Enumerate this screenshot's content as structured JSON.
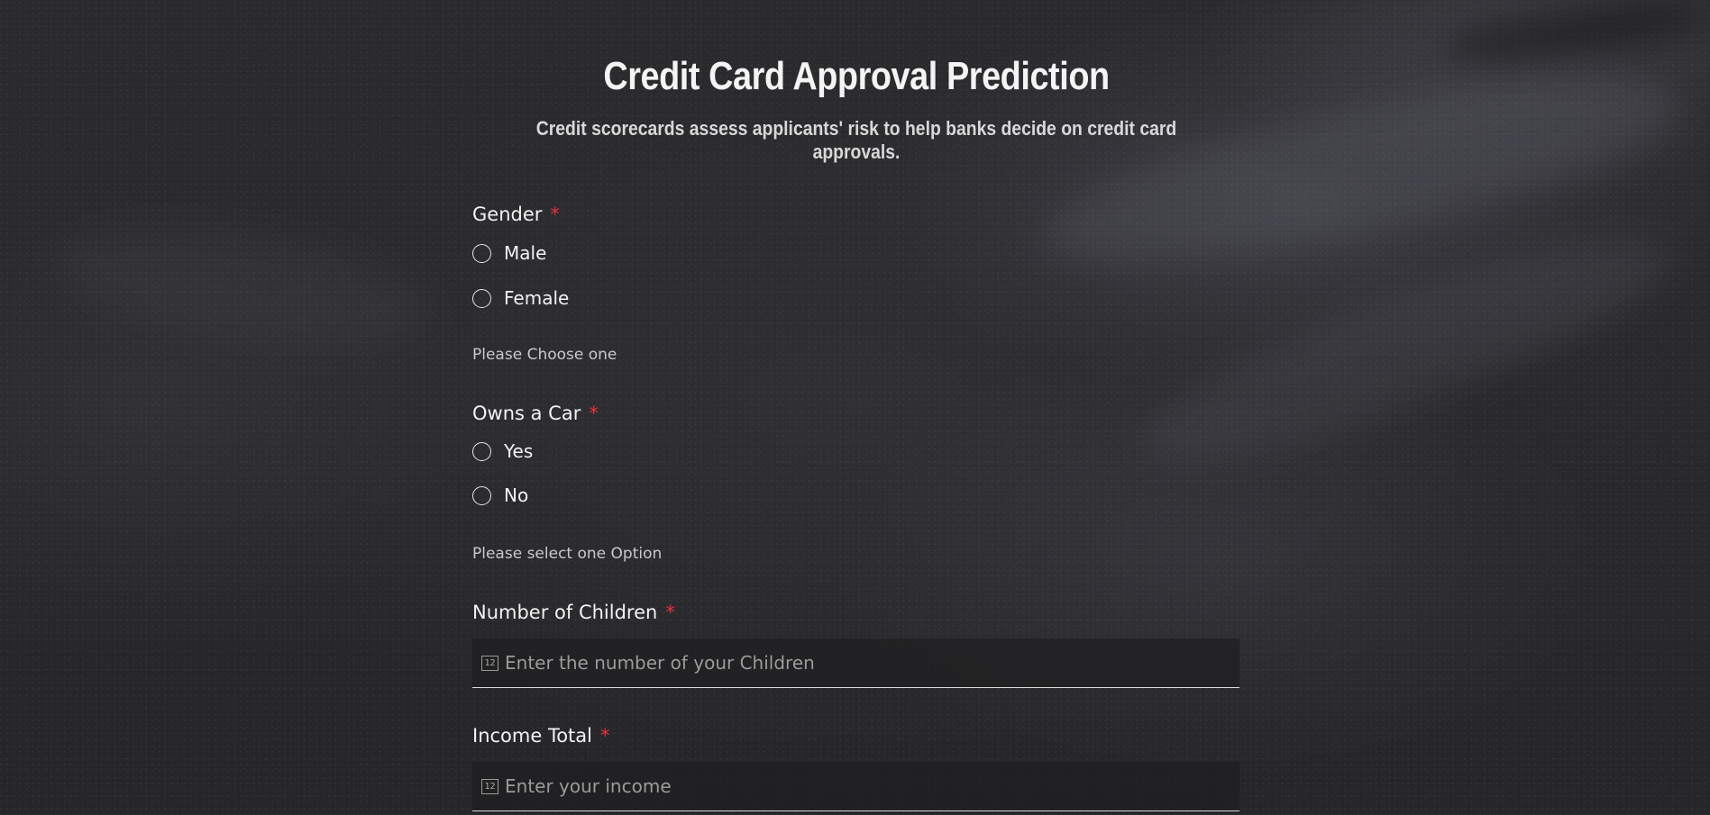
{
  "header": {
    "title": "Credit Card Approval Prediction",
    "subtitle": "Credit scorecards assess applicants' risk to help banks decide on credit card approvals."
  },
  "form": {
    "required_marker": "*",
    "required_marker_color": "#e2323a",
    "gender": {
      "label": "Gender",
      "options": [
        "Male",
        "Female"
      ],
      "hint": "Please Choose one"
    },
    "owns_car": {
      "label": "Owns a Car",
      "options": [
        "Yes",
        "No"
      ],
      "hint": "Please select one Option"
    },
    "children": {
      "label": "Number of Children",
      "icon": "number-icon",
      "icon_text": "12",
      "placeholder": "Enter the number of your Children"
    },
    "income": {
      "label": "Income Total",
      "icon": "number-icon",
      "icon_text": "12",
      "placeholder": "Enter your income"
    }
  }
}
